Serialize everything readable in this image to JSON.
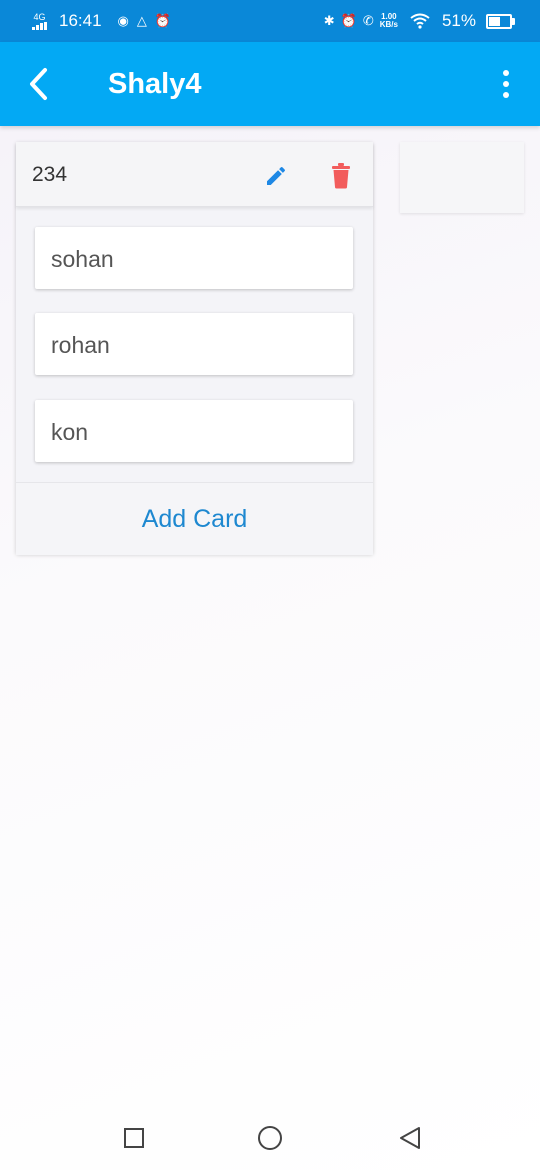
{
  "status_bar": {
    "network": "4G",
    "time": "16:41",
    "speed_value": "1.00",
    "speed_unit": "KB/s",
    "battery_percent": "51%",
    "battery_level": 0.51
  },
  "app_bar": {
    "title": "Shaly4",
    "back_icon": "chevron-left-icon",
    "menu_icon": "more-vertical-icon"
  },
  "list": {
    "title": "234",
    "edit_icon": "pencil-icon",
    "delete_icon": "trash-icon",
    "cards": [
      {
        "text": "sohan"
      },
      {
        "text": "rohan"
      },
      {
        "text": "kon"
      }
    ],
    "add_card_label": "Add Card"
  },
  "colors": {
    "status_bar": "#0a88d8",
    "app_bar": "#03a9f4",
    "edit_icon": "#1e88e5",
    "delete_icon": "#f25c5c",
    "add_card_text": "#1e88d0"
  }
}
